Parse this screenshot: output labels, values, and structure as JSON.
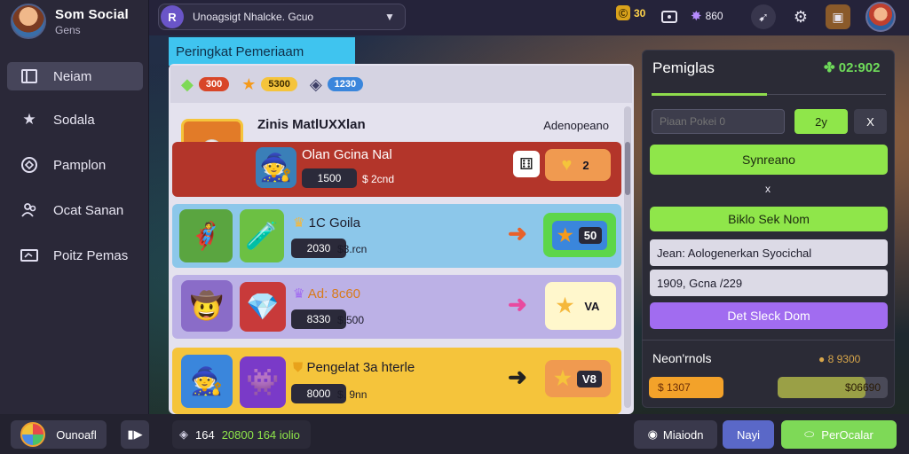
{
  "profile": {
    "name": "Som Social",
    "subtitle": "Gens"
  },
  "sidebar": {
    "items": [
      {
        "label": "Neiam",
        "icon": "book-icon"
      },
      {
        "label": "Sodala",
        "icon": "star-icon"
      },
      {
        "label": "Pamplon",
        "icon": "controller-icon"
      },
      {
        "label": "Ocat Sanan",
        "icon": "people-icon"
      },
      {
        "label": "Poitz Pemas",
        "icon": "wallet-icon"
      }
    ]
  },
  "search": {
    "value": "Unoagsigt Nhalcke. Gcuo"
  },
  "topbar": {
    "coins": "30",
    "gems": "860"
  },
  "leaderboard": {
    "tab_label": "Peringkat Pemeriaam",
    "currencies": [
      "300",
      "5300",
      "1230"
    ],
    "header_title": "Zinis MatlUXXlan",
    "header_right": "Adenopeano",
    "rows": [
      {
        "title": "Olan Gcina Nal",
        "rank": "1500",
        "sub": "$ 2cnd",
        "score": "2"
      },
      {
        "title": "1C Goila",
        "rank": "2030",
        "sub": "$3.rcn",
        "score": "50"
      },
      {
        "title": "Ad: 8c60",
        "rank": "8330",
        "sub": "$.500",
        "score": "VA"
      },
      {
        "title": "Pengelat 3a hterle",
        "rank": "8000",
        "sub": "$. 9nn",
        "score": "V8"
      }
    ]
  },
  "right_panel": {
    "title": "Pemiglas",
    "timer": "02:902",
    "input_placeholder": "Piaan Pokei 0",
    "btn_small_1": "2y",
    "btn_small_2": "X",
    "btn_sync": "Synreano",
    "x_mark": "x",
    "btn_green": "Biklo Sek Nom",
    "info_1": "Jean: Aologenerkan Syocichal",
    "info_2": "1909, Gcna /229",
    "btn_purple": "Det Sleck Dom",
    "footer_label": "Neon'rnols",
    "footer_value": "8 9300",
    "progress_left": "$ 1307",
    "progress_right": "$06690",
    "progress_fraction": 0.8
  },
  "bottom": {
    "left_label": "Ounoafl",
    "mid_value": "164",
    "mid_text": "20800 164 iolio",
    "btn_1": "Miaiodn",
    "btn_2": "Nayi",
    "btn_3": "PerOcalar"
  },
  "colors": {
    "accent_green": "#8fe64a",
    "accent_purple": "#a16cf0",
    "row_red": "#b3352a",
    "row_blue": "#8cc7ea",
    "row_purple": "#bcb1e6",
    "row_yellow": "#f5c43b"
  }
}
